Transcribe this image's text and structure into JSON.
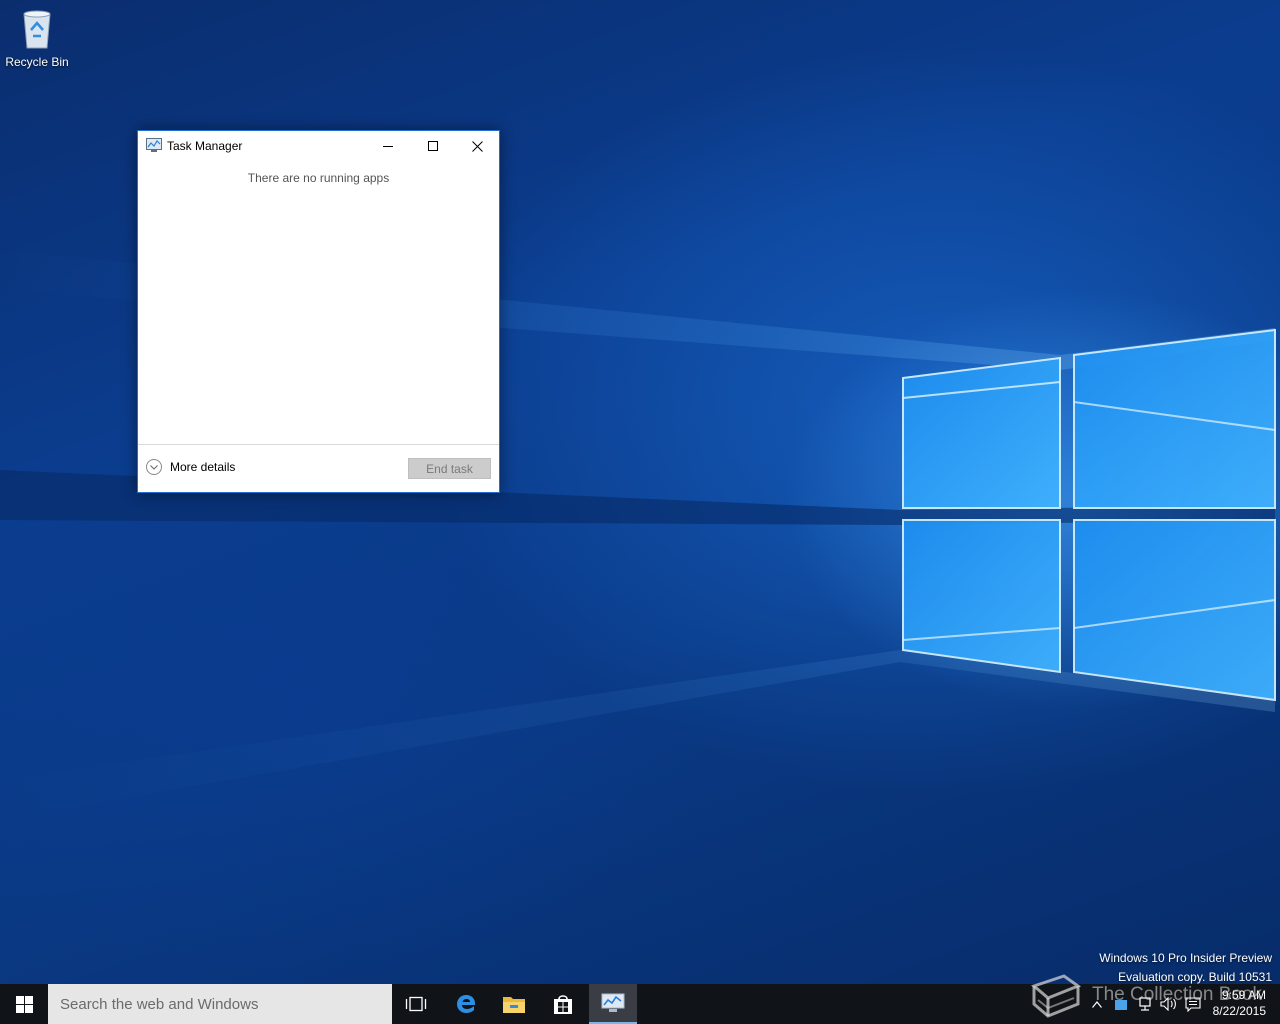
{
  "desktop": {
    "icons": [
      {
        "label": "Recycle Bin",
        "icon": "recycle-bin-icon"
      }
    ],
    "watermark": {
      "line1": "Windows 10 Pro Insider Preview",
      "line2": "Evaluation copy. Build 10531"
    }
  },
  "task_manager": {
    "title": "Task Manager",
    "icon": "task-manager-icon",
    "empty_message": "There are no running apps",
    "more_details_label": "More details",
    "end_task_label": "End task",
    "accent_color": "#1f6fd1"
  },
  "taskbar": {
    "search_placeholder": "Search the web and Windows",
    "pinned": [
      "task-view-icon",
      "edge-icon",
      "file-explorer-icon",
      "store-icon",
      "task-manager-icon"
    ],
    "active_app": "task-manager-icon",
    "clock": {
      "time": "9:59 AM",
      "date": "8/22/2015"
    }
  },
  "overlay": {
    "logo_text": "The Collection Book",
    "logo_icon": "book-icon"
  }
}
